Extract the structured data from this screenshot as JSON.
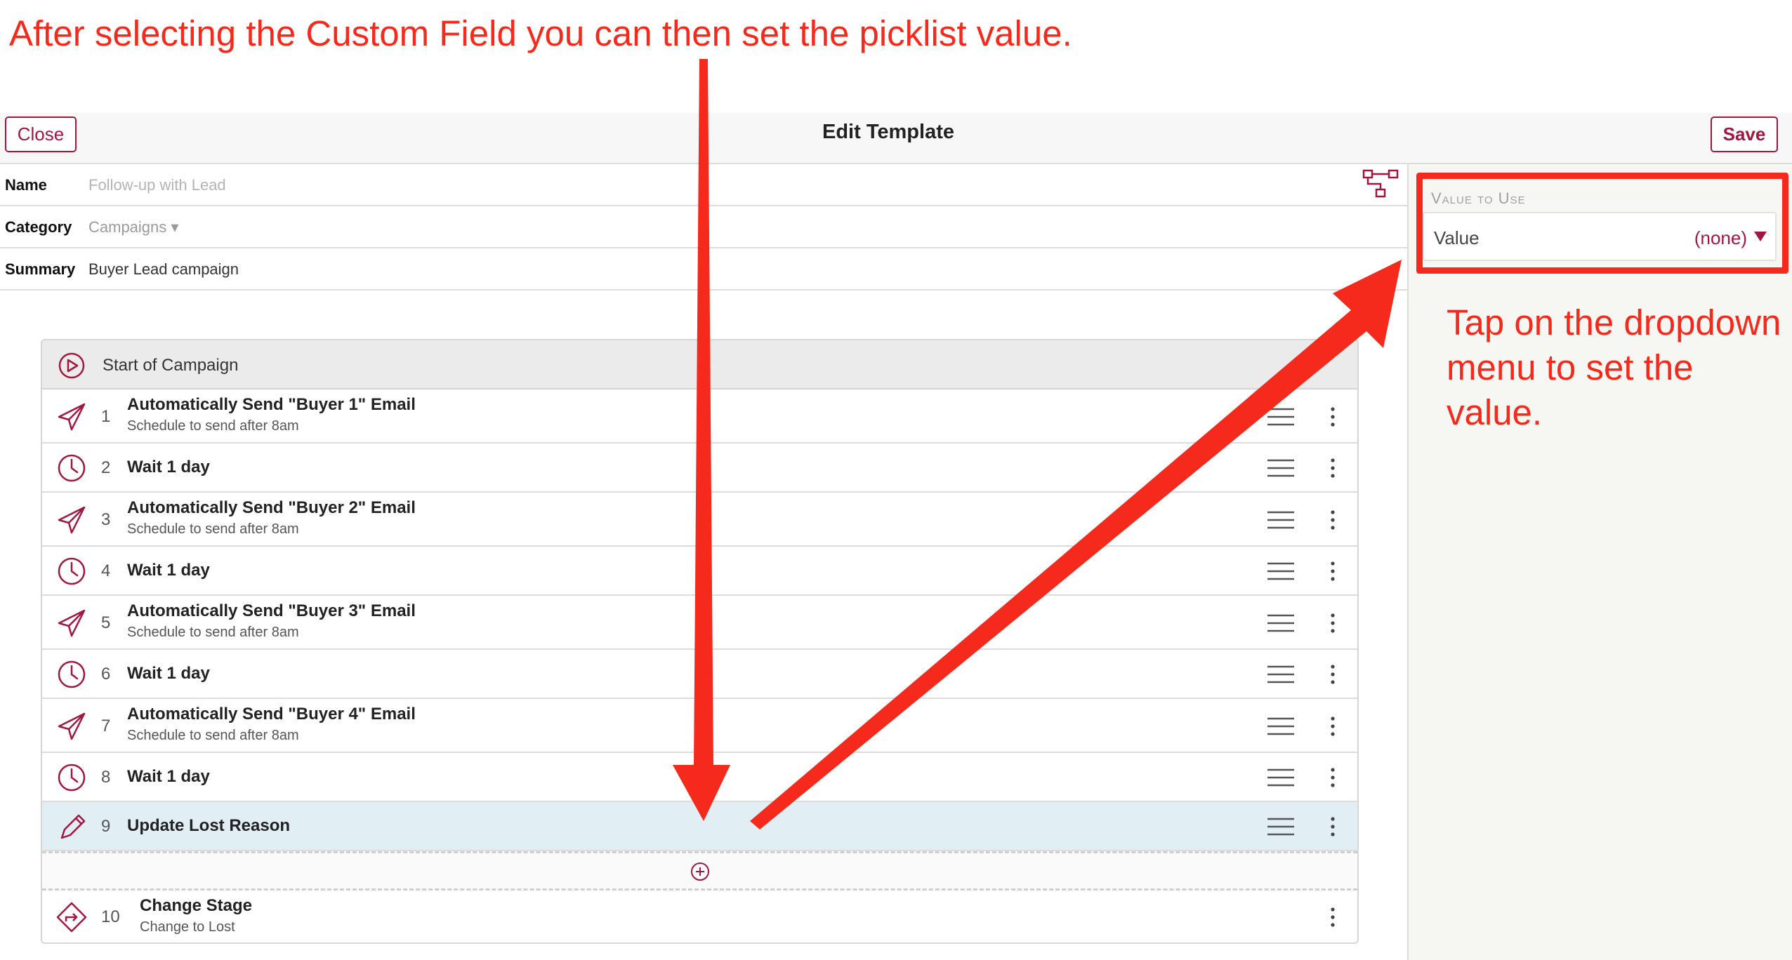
{
  "annotations": {
    "top": "After selecting the Custom Field you can then set the picklist value.",
    "side_line1": "Tap on the dropdown",
    "side_line2": "menu to set the value."
  },
  "header": {
    "close_label": "Close",
    "title": "Edit Template",
    "save_label": "Save"
  },
  "form": {
    "name_label": "Name",
    "name_placeholder": "Follow-up with Lead",
    "category_label": "Category",
    "category_value": "Campaigns ▾",
    "summary_label": "Summary",
    "summary_value": "Buyer Lead campaign"
  },
  "value_panel": {
    "heading": "Value to Use",
    "label": "Value",
    "value": "(none)"
  },
  "campaign": {
    "start_label": "Start of Campaign",
    "steps": [
      {
        "num": "1",
        "title": "Automatically Send \"Buyer 1\" Email",
        "subtitle": "Schedule to send after 8am",
        "icon": "paper-plane-icon"
      },
      {
        "num": "2",
        "title": "Wait 1 day",
        "subtitle": "",
        "icon": "clock-icon"
      },
      {
        "num": "3",
        "title": "Automatically Send \"Buyer 2\" Email",
        "subtitle": "Schedule to send after 8am",
        "icon": "paper-plane-icon"
      },
      {
        "num": "4",
        "title": "Wait 1 day",
        "subtitle": "",
        "icon": "clock-icon"
      },
      {
        "num": "5",
        "title": "Automatically Send \"Buyer 3\" Email",
        "subtitle": "Schedule to send after 8am",
        "icon": "paper-plane-icon"
      },
      {
        "num": "6",
        "title": "Wait 1 day",
        "subtitle": "",
        "icon": "clock-icon"
      },
      {
        "num": "7",
        "title": "Automatically Send \"Buyer 4\" Email",
        "subtitle": "Schedule to send after 8am",
        "icon": "paper-plane-icon"
      },
      {
        "num": "8",
        "title": "Wait 1 day",
        "subtitle": "",
        "icon": "clock-icon"
      },
      {
        "num": "9",
        "title": "Update Lost Reason",
        "subtitle": "",
        "icon": "pencil-icon"
      },
      {
        "num": "10",
        "title": "Change Stage",
        "subtitle": "Change to Lost",
        "icon": "direction-sign-icon"
      }
    ]
  },
  "colors": {
    "accent": "#a3163f",
    "annotation": "#f5291c",
    "selected_row": "#e1eff5"
  }
}
